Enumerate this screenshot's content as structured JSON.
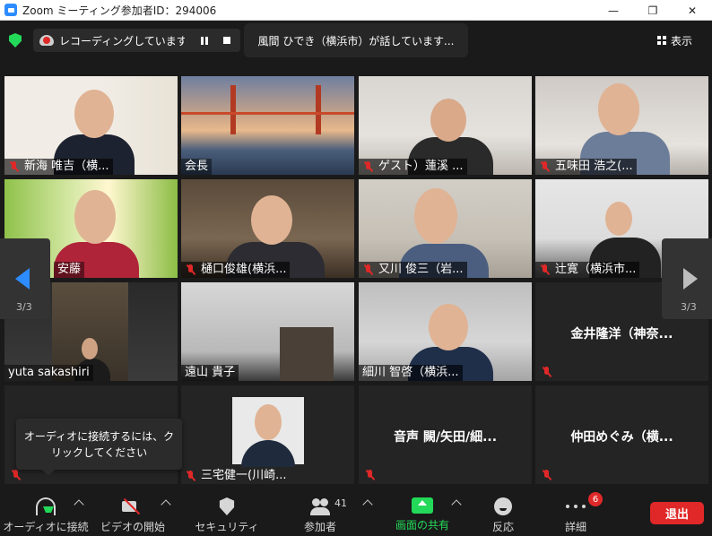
{
  "window": {
    "title": "Zoom ミーティング参加者ID：294006"
  },
  "topbar": {
    "recording_text": "レコーディングしています...",
    "speaking_text": "風間  ひでき（横浜市）が話しています...",
    "view_label": "表示"
  },
  "tiles": [
    {
      "name": "新海 唯吉（横..."
    },
    {
      "name": "会長"
    },
    {
      "name": "ゲスト）蓮溪 ..."
    },
    {
      "name": "五味田 浩之(..."
    },
    {
      "name": "安藤"
    },
    {
      "name": "樋口俊雄(横浜..."
    },
    {
      "name": "又川 俊三（岩..."
    },
    {
      "name": "辻寛（横浜市..."
    },
    {
      "name": "yuta sakashiri"
    },
    {
      "name": "遠山 貴子"
    },
    {
      "name": "細川 智啓（横浜..."
    },
    {
      "name": "金井隆洋（神奈..."
    },
    {
      "name": "三宅健一(川崎..."
    },
    {
      "name": "音声 闕/矢田/細..."
    },
    {
      "name": "仲田めぐみ（横..."
    }
  ],
  "paging": {
    "left": "3/3",
    "right": "3/3"
  },
  "tooltip": {
    "text_line1": "オーディオに接続するには、ク",
    "text_line2": "リックしてください"
  },
  "toolbar": {
    "audio_label": "オーディオに接続",
    "video_label": "ビデオの開始",
    "security_label": "セキュリティ",
    "participants_label": "参加者",
    "participants_count": "41",
    "share_label": "画面の共有",
    "reactions_label": "反応",
    "more_label": "詳細",
    "more_badge": "6",
    "leave_label": "退出"
  },
  "colors": {
    "accent": "#2d8cff",
    "green": "#23d959",
    "red": "#e02828",
    "bg": "#1a1a1a"
  }
}
